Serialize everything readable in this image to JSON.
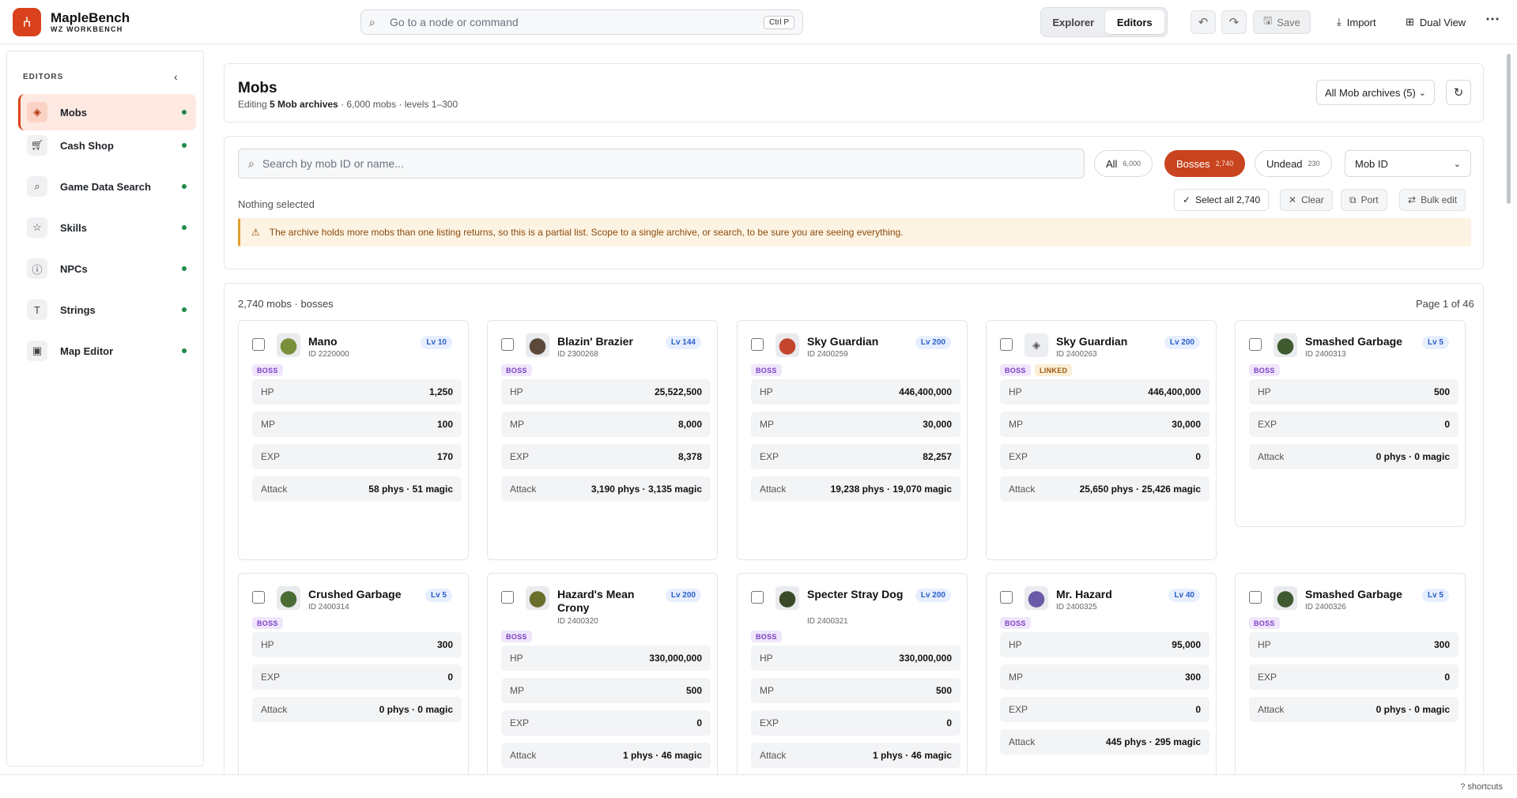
{
  "brand": {
    "name": "MapleBench",
    "sub": "WZ WORKBENCH"
  },
  "command": {
    "placeholder": "Go to a node or command",
    "shortcut": "Ctrl P"
  },
  "mode_tabs": [
    {
      "label": "Explorer"
    },
    {
      "label": "Editors"
    }
  ],
  "toolbar": {
    "save": "Save",
    "import": "Import",
    "dual_view": "Dual View"
  },
  "sidebar": {
    "heading": "EDITORS",
    "items": [
      {
        "label": "Mobs",
        "icon": "layers-icon"
      },
      {
        "label": "Cash Shop",
        "icon": "cart-icon"
      },
      {
        "label": "Game Data Search",
        "icon": "search-icon"
      },
      {
        "label": "Skills",
        "icon": "star-icon"
      },
      {
        "label": "NPCs",
        "icon": "info-icon"
      },
      {
        "label": "Strings",
        "icon": "text-icon"
      },
      {
        "label": "Map Editor",
        "icon": "image-icon"
      }
    ]
  },
  "header": {
    "title": "Mobs",
    "sub_prefix": "Editing ",
    "sub_bold": "5 Mob archives",
    "sub_rest": " · 6,000 mobs · levels 1–300",
    "archive_select": "All Mob archives (5)"
  },
  "filters": {
    "search_placeholder": "Search by mob ID or name...",
    "chips": [
      {
        "label": "All",
        "count": "6,000"
      },
      {
        "label": "Bosses",
        "count": "2,740"
      },
      {
        "label": "Undead",
        "count": "230"
      }
    ],
    "sort": "Mob ID",
    "selection": "Nothing selected",
    "select_all": "Select all 2,740",
    "clear": "Clear",
    "port": "Port",
    "bulk_edit": "Bulk edit",
    "warning": "The archive holds more mobs than one listing returns, so this is a partial list. Scope to a single archive, or search, to be sure you are seeing everything."
  },
  "list": {
    "summary": "2,740 mobs · bosses",
    "page": "Page 1 of 46",
    "cards": [
      {
        "name": "Mano",
        "id": "ID 2220000",
        "level": "Lv 10",
        "tags": [
          "BOSS"
        ],
        "stats": [
          [
            "HP",
            "1,250"
          ],
          [
            "MP",
            "100"
          ],
          [
            "EXP",
            "170"
          ],
          [
            "Attack",
            "58 phys · 51 magic"
          ]
        ]
      },
      {
        "name": "Blazin' Brazier",
        "id": "ID 2300268",
        "level": "Lv 144",
        "tags": [
          "BOSS"
        ],
        "stats": [
          [
            "HP",
            "25,522,500"
          ],
          [
            "MP",
            "8,000"
          ],
          [
            "EXP",
            "8,378"
          ],
          [
            "Attack",
            "3,190 phys · 3,135 magic"
          ]
        ]
      },
      {
        "name": "Sky Guardian",
        "id": "ID 2400259",
        "level": "Lv 200",
        "tags": [
          "BOSS"
        ],
        "stats": [
          [
            "HP",
            "446,400,000"
          ],
          [
            "MP",
            "30,000"
          ],
          [
            "EXP",
            "82,257"
          ],
          [
            "Attack",
            "19,238 phys · 19,070 magic"
          ]
        ]
      },
      {
        "name": "Sky Guardian",
        "id": "ID 2400263",
        "level": "Lv 200",
        "tags": [
          "BOSS",
          "LINKED"
        ],
        "stats": [
          [
            "HP",
            "446,400,000"
          ],
          [
            "MP",
            "30,000"
          ],
          [
            "EXP",
            "0"
          ],
          [
            "Attack",
            "25,650 phys · 25,426 magic"
          ]
        ]
      },
      {
        "name": "Smashed Garbage",
        "id": "ID 2400313",
        "level": "Lv 5",
        "tags": [
          "BOSS"
        ],
        "stats": [
          [
            "HP",
            "500"
          ],
          [
            "EXP",
            "0"
          ],
          [
            "Attack",
            "0 phys · 0 magic"
          ]
        ]
      },
      {
        "name": "Crushed Garbage",
        "id": "ID 2400314",
        "level": "Lv 5",
        "tags": [
          "BOSS"
        ],
        "stats": [
          [
            "HP",
            "300"
          ],
          [
            "EXP",
            "0"
          ],
          [
            "Attack",
            "0 phys · 0 magic"
          ]
        ]
      },
      {
        "name": "Hazard's Mean Crony",
        "id": "ID 2400320",
        "level": "Lv 200",
        "tags": [
          "BOSS"
        ],
        "stats": [
          [
            "HP",
            "330,000,000"
          ],
          [
            "MP",
            "500"
          ],
          [
            "EXP",
            "0"
          ],
          [
            "Attack",
            "1 phys · 46 magic"
          ]
        ]
      },
      {
        "name": "Specter Stray Dog",
        "id": "ID 2400321",
        "level": "Lv 200",
        "tags": [
          "BOSS"
        ],
        "stats": [
          [
            "HP",
            "330,000,000"
          ],
          [
            "MP",
            "500"
          ],
          [
            "EXP",
            "0"
          ],
          [
            "Attack",
            "1 phys · 46 magic"
          ]
        ]
      },
      {
        "name": "Mr. Hazard",
        "id": "ID 2400325",
        "level": "Lv 40",
        "tags": [
          "BOSS"
        ],
        "stats": [
          [
            "HP",
            "95,000"
          ],
          [
            "MP",
            "300"
          ],
          [
            "EXP",
            "0"
          ],
          [
            "Attack",
            "445 phys · 295 magic"
          ]
        ]
      },
      {
        "name": "Smashed Garbage",
        "id": "ID 2400326",
        "level": "Lv 5",
        "tags": [
          "BOSS"
        ],
        "stats": [
          [
            "HP",
            "300"
          ],
          [
            "EXP",
            "0"
          ],
          [
            "Attack",
            "0 phys · 0 magic"
          ]
        ]
      }
    ]
  },
  "footer": {
    "shortcuts": "? shortcuts"
  },
  "colors": {
    "accent": "#d9421d",
    "boss_tag": "#7b3fc4",
    "level_badge": "#2b5fc7",
    "status_dot": "#1f8a4c"
  }
}
